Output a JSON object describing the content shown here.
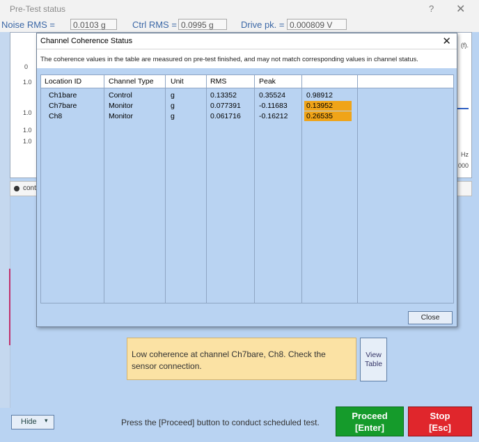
{
  "window": {
    "title": "Pre-Test status",
    "help_glyph": "?",
    "close_glyph": "✕"
  },
  "metrics": {
    "noise_label": "Noise RMS =",
    "noise_value": "0.0103 g",
    "ctrl_label": "Ctrl RMS =",
    "ctrl_value": "0.0995 g",
    "drive_label": "Drive pk. =",
    "drive_value": "0.000809 V"
  },
  "background_plot": {
    "right_unit_top": "(f).",
    "right_hz": "Hz",
    "right_num": "000",
    "y_labels": [
      "0",
      "1.0",
      "1.0",
      "1.0",
      "1.0"
    ],
    "radio_label": "cont"
  },
  "dialog": {
    "title": "Channel Coherence Status",
    "close_glyph": "✕",
    "note": "The coherence values in the table are measured on pre-test finished, and may not match corresponding values in channel status.",
    "columns": [
      "Location ID",
      "Channel Type",
      "Unit",
      "RMS",
      "Peak",
      ""
    ],
    "rows": [
      {
        "location": "Ch1bare",
        "type": "Control",
        "unit": "g",
        "rms": "0.13352",
        "peak": "0.35524",
        "coherence": "0.98912",
        "low": false
      },
      {
        "location": "Ch7bare",
        "type": "Monitor",
        "unit": "g",
        "rms": "0.077391",
        "peak": "-0.11683",
        "coherence": "0.13952",
        "low": true
      },
      {
        "location": "Ch8",
        "type": "Monitor",
        "unit": "g",
        "rms": "0.061716",
        "peak": "-0.16212",
        "coherence": "0.26535",
        "low": true
      }
    ],
    "close_button": "Close"
  },
  "warning": {
    "text": "Low coherence at channel Ch7bare, Ch8. Check the sensor connection."
  },
  "view_table": {
    "line1": "View",
    "line2": "Table"
  },
  "bottom": {
    "hide_label": "Hide",
    "hide_caret": "▾",
    "instruction": "Press the [Proceed] button to conduct scheduled test.",
    "proceed_line1": "Proceed",
    "proceed_line2": "[Enter]",
    "stop_line1": "Stop",
    "stop_line2": "[Esc]"
  },
  "colors": {
    "low_coherence": "#f0a418",
    "proceed": "#159b2b",
    "stop": "#e0262c",
    "panel": "#b9d3f2"
  }
}
